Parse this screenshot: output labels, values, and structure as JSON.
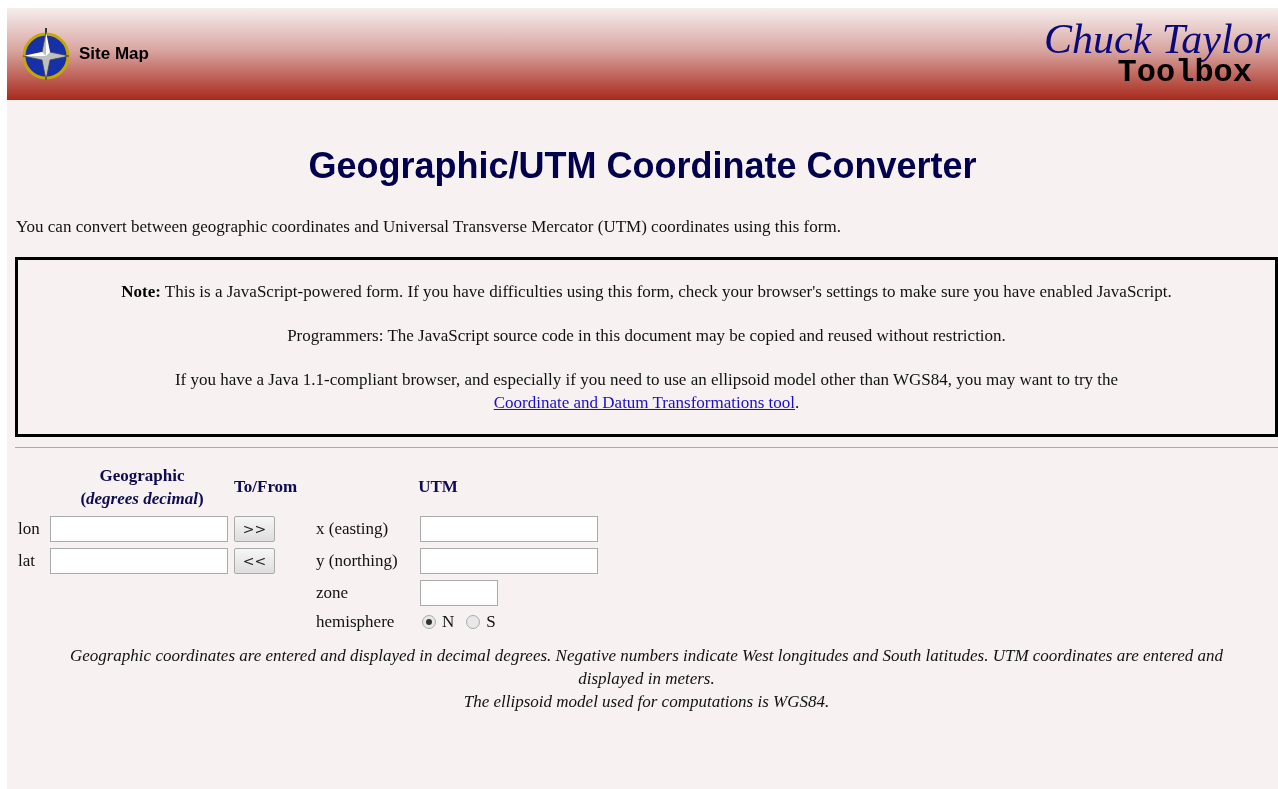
{
  "header": {
    "site_map": "Site Map",
    "logo_top": "Chuck Taylor",
    "logo_bottom": "Toolbox"
  },
  "title": "Geographic/UTM Coordinate Converter",
  "intro": "You can convert between geographic coordinates and Universal Transverse Mercator (UTM) coordinates using this form.",
  "note_box": {
    "paragraphs": [
      {
        "text": "**Note:** This is a JavaScript-powered form. If you have difficulties using this form, check your browser's settings to make sure you have enabled JavaScript."
      },
      {
        "text": "Programmers: The JavaScript source code in this document may be copied and reused without restriction."
      },
      {
        "text": "If you have a Java 1.1-compliant browser, and especially if you need to use an ellipsoid model other than WGS84, you may want to try the",
        "link": "Coordinate and Datum Transformations tool",
        "after": "."
      }
    ]
  },
  "form": {
    "headers": {
      "geographic": "Geographic",
      "geographic_sub": "(*degrees decimal*)",
      "to_from": "To/From",
      "utm": "UTM"
    },
    "geographic_fields": [
      {
        "label": "lon",
        "button": ">>"
      },
      {
        "label": "lat",
        "button": "<<"
      }
    ],
    "utm_fields": [
      {
        "label": "x (easting)",
        "kind": "wide"
      },
      {
        "label": "y (northing)",
        "kind": "wide"
      },
      {
        "label": "zone",
        "kind": "short"
      }
    ],
    "hemisphere": {
      "label": "hemisphere",
      "options": [
        {
          "label": "N",
          "selected": true
        },
        {
          "label": "S",
          "selected": false
        }
      ]
    }
  },
  "footer": [
    "Geographic coordinates are entered and displayed in decimal degrees. Negative numbers indicate West longitudes and South latitudes. UTM coordinates are entered and displayed in meters.",
    "The ellipsoid model used for computations is WGS84."
  ]
}
